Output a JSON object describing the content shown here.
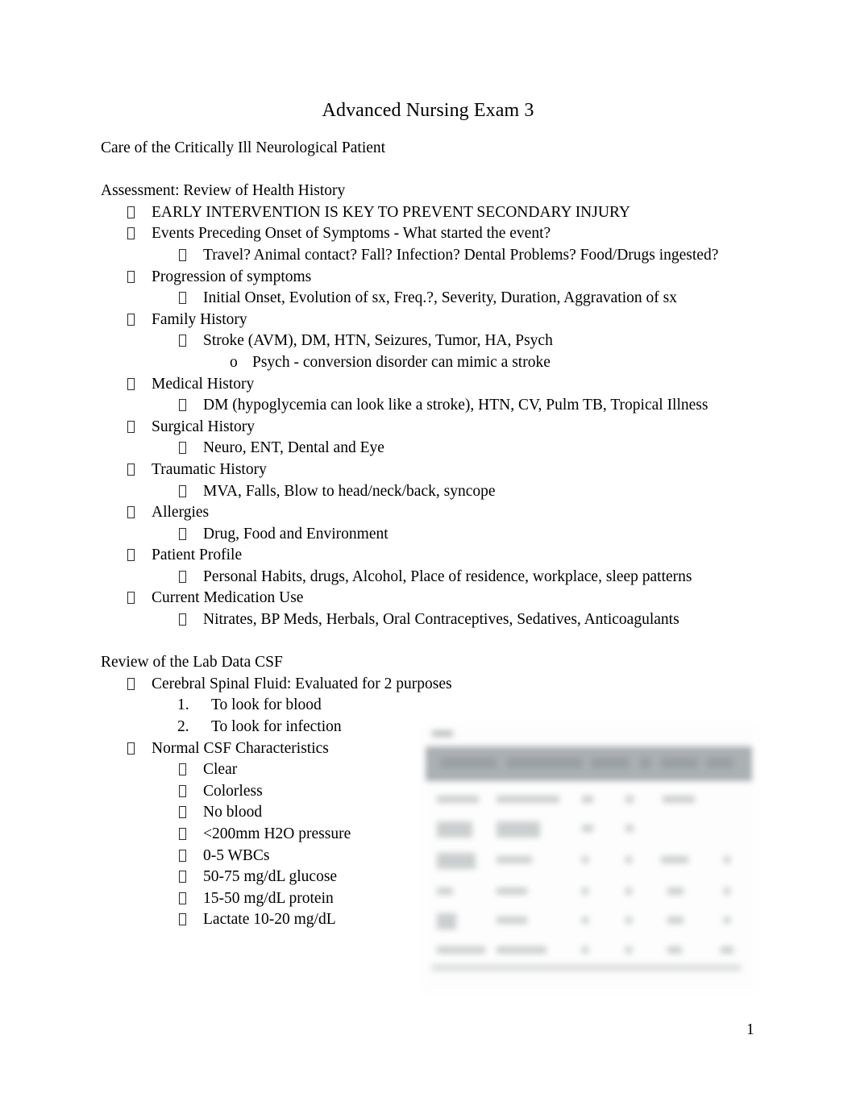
{
  "document": {
    "title": "Advanced Nursing Exam 3",
    "page_number": "1"
  },
  "content": {
    "subtitle": "Care of the Critically Ill Neurological Patient",
    "section1_heading": "Assessment: Review of Health History",
    "section2_heading": "Review of the Lab Data CSF",
    "lines": [
      {
        "level": 1,
        "marker": "tofu",
        "text": "EARLY INTERVENTION IS KEY TO PREVENT SECONDARY INJURY"
      },
      {
        "level": 1,
        "marker": "tofu",
        "text": "Events Preceding Onset of Symptoms - What started the event?"
      },
      {
        "level": 2,
        "marker": "tofu",
        "text": "Travel? Animal contact? Fall? Infection? Dental Problems? Food/Drugs ingested?"
      },
      {
        "level": 1,
        "marker": "tofu",
        "text": "Progression of symptoms"
      },
      {
        "level": 2,
        "marker": "tofu",
        "text": "Initial Onset, Evolution of sx, Freq.?, Severity, Duration, Aggravation of sx"
      },
      {
        "level": 1,
        "marker": "tofu",
        "text": "Family History"
      },
      {
        "level": 2,
        "marker": "tofu",
        "text": "Stroke (AVM), DM, HTN, Seizures, Tumor, HA, Psych"
      },
      {
        "level": 3,
        "marker": "o",
        "text": "Psych - conversion disorder can mimic a stroke"
      },
      {
        "level": 1,
        "marker": "tofu",
        "text": "Medical History"
      },
      {
        "level": 2,
        "marker": "tofu",
        "text": "DM (hypoglycemia can look like a stroke), HTN, CV, Pulm TB, Tropical Illness"
      },
      {
        "level": 1,
        "marker": "tofu",
        "text": "Surgical History"
      },
      {
        "level": 2,
        "marker": "tofu",
        "text": "Neuro, ENT, Dental and Eye"
      },
      {
        "level": 1,
        "marker": "tofu",
        "text": "Traumatic History"
      },
      {
        "level": 2,
        "marker": "tofu",
        "text": "MVA, Falls, Blow to head/neck/back, syncope"
      },
      {
        "level": 1,
        "marker": "tofu",
        "text": "Allergies"
      },
      {
        "level": 2,
        "marker": "tofu",
        "text": "Drug, Food and Environment"
      },
      {
        "level": 1,
        "marker": "tofu",
        "text": "Patient Profile"
      },
      {
        "level": 2,
        "marker": "tofu",
        "text": "Personal Habits, drugs, Alcohol, Place of residence, workplace, sleep patterns"
      },
      {
        "level": 1,
        "marker": "tofu",
        "text": "Current Medication Use"
      },
      {
        "level": 2,
        "marker": "tofu",
        "text": "Nitrates, BP Meds, Herbals, Oral Contraceptives, Sedatives, Anticoagulants"
      }
    ],
    "lab_lines": [
      {
        "level": 1,
        "marker": "tofu",
        "text": "Cerebral Spinal Fluid: Evaluated for 2 purposes"
      },
      {
        "level": "num",
        "marker": "1.",
        "text": "To look for blood"
      },
      {
        "level": "num",
        "marker": "2.",
        "text": "To look for infection"
      },
      {
        "level": 1,
        "marker": "tofu",
        "text": "Normal CSF Characteristics"
      },
      {
        "level": 2,
        "marker": "tofu",
        "text": "Clear"
      },
      {
        "level": 2,
        "marker": "tofu",
        "text": "Colorless"
      },
      {
        "level": 2,
        "marker": "tofu",
        "text": "No blood"
      },
      {
        "level": 2,
        "marker": "tofu",
        "text": "<200mm H2O pressure"
      },
      {
        "level": 2,
        "marker": "tofu",
        "text": "0-5 WBCs"
      },
      {
        "level": 2,
        "marker": "tofu",
        "text": "50-75 mg/dL glucose"
      },
      {
        "level": 2,
        "marker": "tofu",
        "text": "15-50 mg/dL protein"
      },
      {
        "level": 2,
        "marker": "tofu",
        "text": "Lactate 10-20 mg/dL"
      }
    ]
  },
  "figure": {
    "description": "blurred embedded table image (illegible)",
    "header_color": "#a7acaf",
    "background_color": "#fdfdfd",
    "cell_color": "#c9cccd"
  },
  "colors": {
    "page_background": "#ffffff",
    "text": "#000000"
  }
}
